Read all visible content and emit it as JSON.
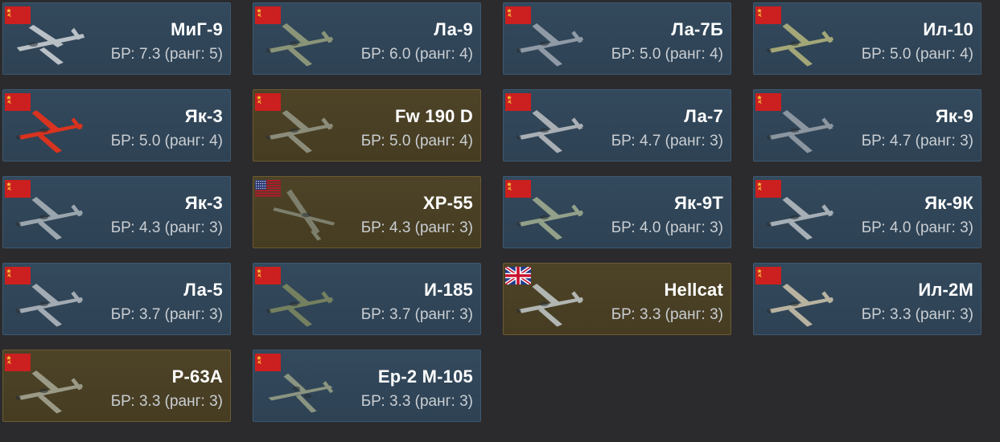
{
  "vehicles": [
    {
      "name": "МиГ-9",
      "br": "БР: 7.3 (ранг: 5)",
      "nation": "ussr",
      "nation_icon": "ussr-flag-icon",
      "plane_icon": "jet-plane-icon",
      "premium": false,
      "plane_color": "#b9c0c6"
    },
    {
      "name": "Ла-9",
      "br": "БР: 6.0 (ранг: 4)",
      "nation": "ussr",
      "nation_icon": "ussr-flag-icon",
      "plane_icon": "fighter-plane-icon",
      "premium": false,
      "plane_color": "#8a9478"
    },
    {
      "name": "Ла-7Б",
      "br": "БР: 5.0 (ранг: 4)",
      "nation": "ussr",
      "nation_icon": "ussr-flag-icon",
      "plane_icon": "fighter-plane-icon",
      "premium": false,
      "plane_color": "#8f9aa6"
    },
    {
      "name": "Ил-10",
      "br": "БР: 5.0 (ранг: 4)",
      "nation": "ussr",
      "nation_icon": "ussr-flag-icon",
      "plane_icon": "attacker-plane-icon",
      "premium": false,
      "plane_color": "#a3a778"
    },
    {
      "name": "Як-3",
      "br": "БР: 5.0 (ранг: 4)",
      "nation": "ussr",
      "nation_icon": "ussr-flag-icon",
      "plane_icon": "fighter-plane-icon",
      "premium": false,
      "plane_color": "#d9331f"
    },
    {
      "name": "Fw 190 D",
      "br": "БР: 5.0 (ранг: 4)",
      "nation": "ussr",
      "nation_icon": "ussr-flag-icon",
      "plane_icon": "fighter-plane-icon",
      "premium": true,
      "plane_color": "#8c8c7a"
    },
    {
      "name": "Ла-7",
      "br": "БР: 4.7 (ранг: 3)",
      "nation": "ussr",
      "nation_icon": "ussr-flag-icon",
      "plane_icon": "fighter-plane-icon",
      "premium": false,
      "plane_color": "#a9afb5"
    },
    {
      "name": "Як-9",
      "br": "БР: 4.7 (ранг: 3)",
      "nation": "ussr",
      "nation_icon": "ussr-flag-icon",
      "plane_icon": "fighter-plane-icon",
      "premium": false,
      "plane_color": "#8c96a0"
    },
    {
      "name": "Як-3",
      "br": "БР: 4.3 (ранг: 3)",
      "nation": "ussr",
      "nation_icon": "ussr-flag-icon",
      "plane_icon": "fighter-plane-icon",
      "premium": false,
      "plane_color": "#9aa5ae"
    },
    {
      "name": "XP-55",
      "br": "БР: 4.3 (ранг: 3)",
      "nation": "usa",
      "nation_icon": "usa-flag-icon",
      "plane_icon": "pusher-plane-icon",
      "premium": true,
      "plane_color": "#7d7f6c"
    },
    {
      "name": "Як-9Т",
      "br": "БР: 4.0 (ранг: 3)",
      "nation": "ussr",
      "nation_icon": "ussr-flag-icon",
      "plane_icon": "fighter-plane-icon",
      "premium": false,
      "plane_color": "#93a08a"
    },
    {
      "name": "Як-9К",
      "br": "БР: 4.0 (ранг: 3)",
      "nation": "ussr",
      "nation_icon": "ussr-flag-icon",
      "plane_icon": "fighter-plane-icon",
      "premium": false,
      "plane_color": "#a6aeb6"
    },
    {
      "name": "Ла-5",
      "br": "БР: 3.7 (ранг: 3)",
      "nation": "ussr",
      "nation_icon": "ussr-flag-icon",
      "plane_icon": "fighter-plane-icon",
      "premium": false,
      "plane_color": "#a2abb3"
    },
    {
      "name": "И-185",
      "br": "БР: 3.7 (ранг: 3)",
      "nation": "ussr",
      "nation_icon": "ussr-flag-icon",
      "plane_icon": "fighter-plane-icon",
      "premium": false,
      "plane_color": "#74805f"
    },
    {
      "name": "Hellcat",
      "br": "БР: 3.3 (ранг: 3)",
      "nation": "uk",
      "nation_icon": "uk-flag-icon",
      "plane_icon": "fighter-plane-icon",
      "premium": true,
      "plane_color": "#b2b6b3"
    },
    {
      "name": "Ил-2М",
      "br": "БР: 3.3 (ранг: 3)",
      "nation": "ussr",
      "nation_icon": "ussr-flag-icon",
      "plane_icon": "attacker-plane-icon",
      "premium": false,
      "plane_color": "#b8b2a0"
    },
    {
      "name": "P-63A",
      "br": "БР: 3.3 (ранг: 3)",
      "nation": "ussr",
      "nation_icon": "ussr-flag-icon",
      "plane_icon": "fighter-plane-icon",
      "premium": true,
      "plane_color": "#9a9a86"
    },
    {
      "name": "Ер-2 М-105",
      "br": "БР: 3.3 (ранг: 3)",
      "nation": "ussr",
      "nation_icon": "ussr-flag-icon",
      "plane_icon": "bomber-plane-icon",
      "premium": false,
      "plane_color": "#8a9480"
    }
  ],
  "colors": {
    "background": "#2b2b2d",
    "card_regular": "#31475a",
    "card_regular_border": "#3d5870",
    "card_premium": "#4a4025",
    "card_premium_border": "#6b5a32",
    "ussr_red": "#cc1f1f",
    "ussr_gold": "#f2c23a"
  }
}
